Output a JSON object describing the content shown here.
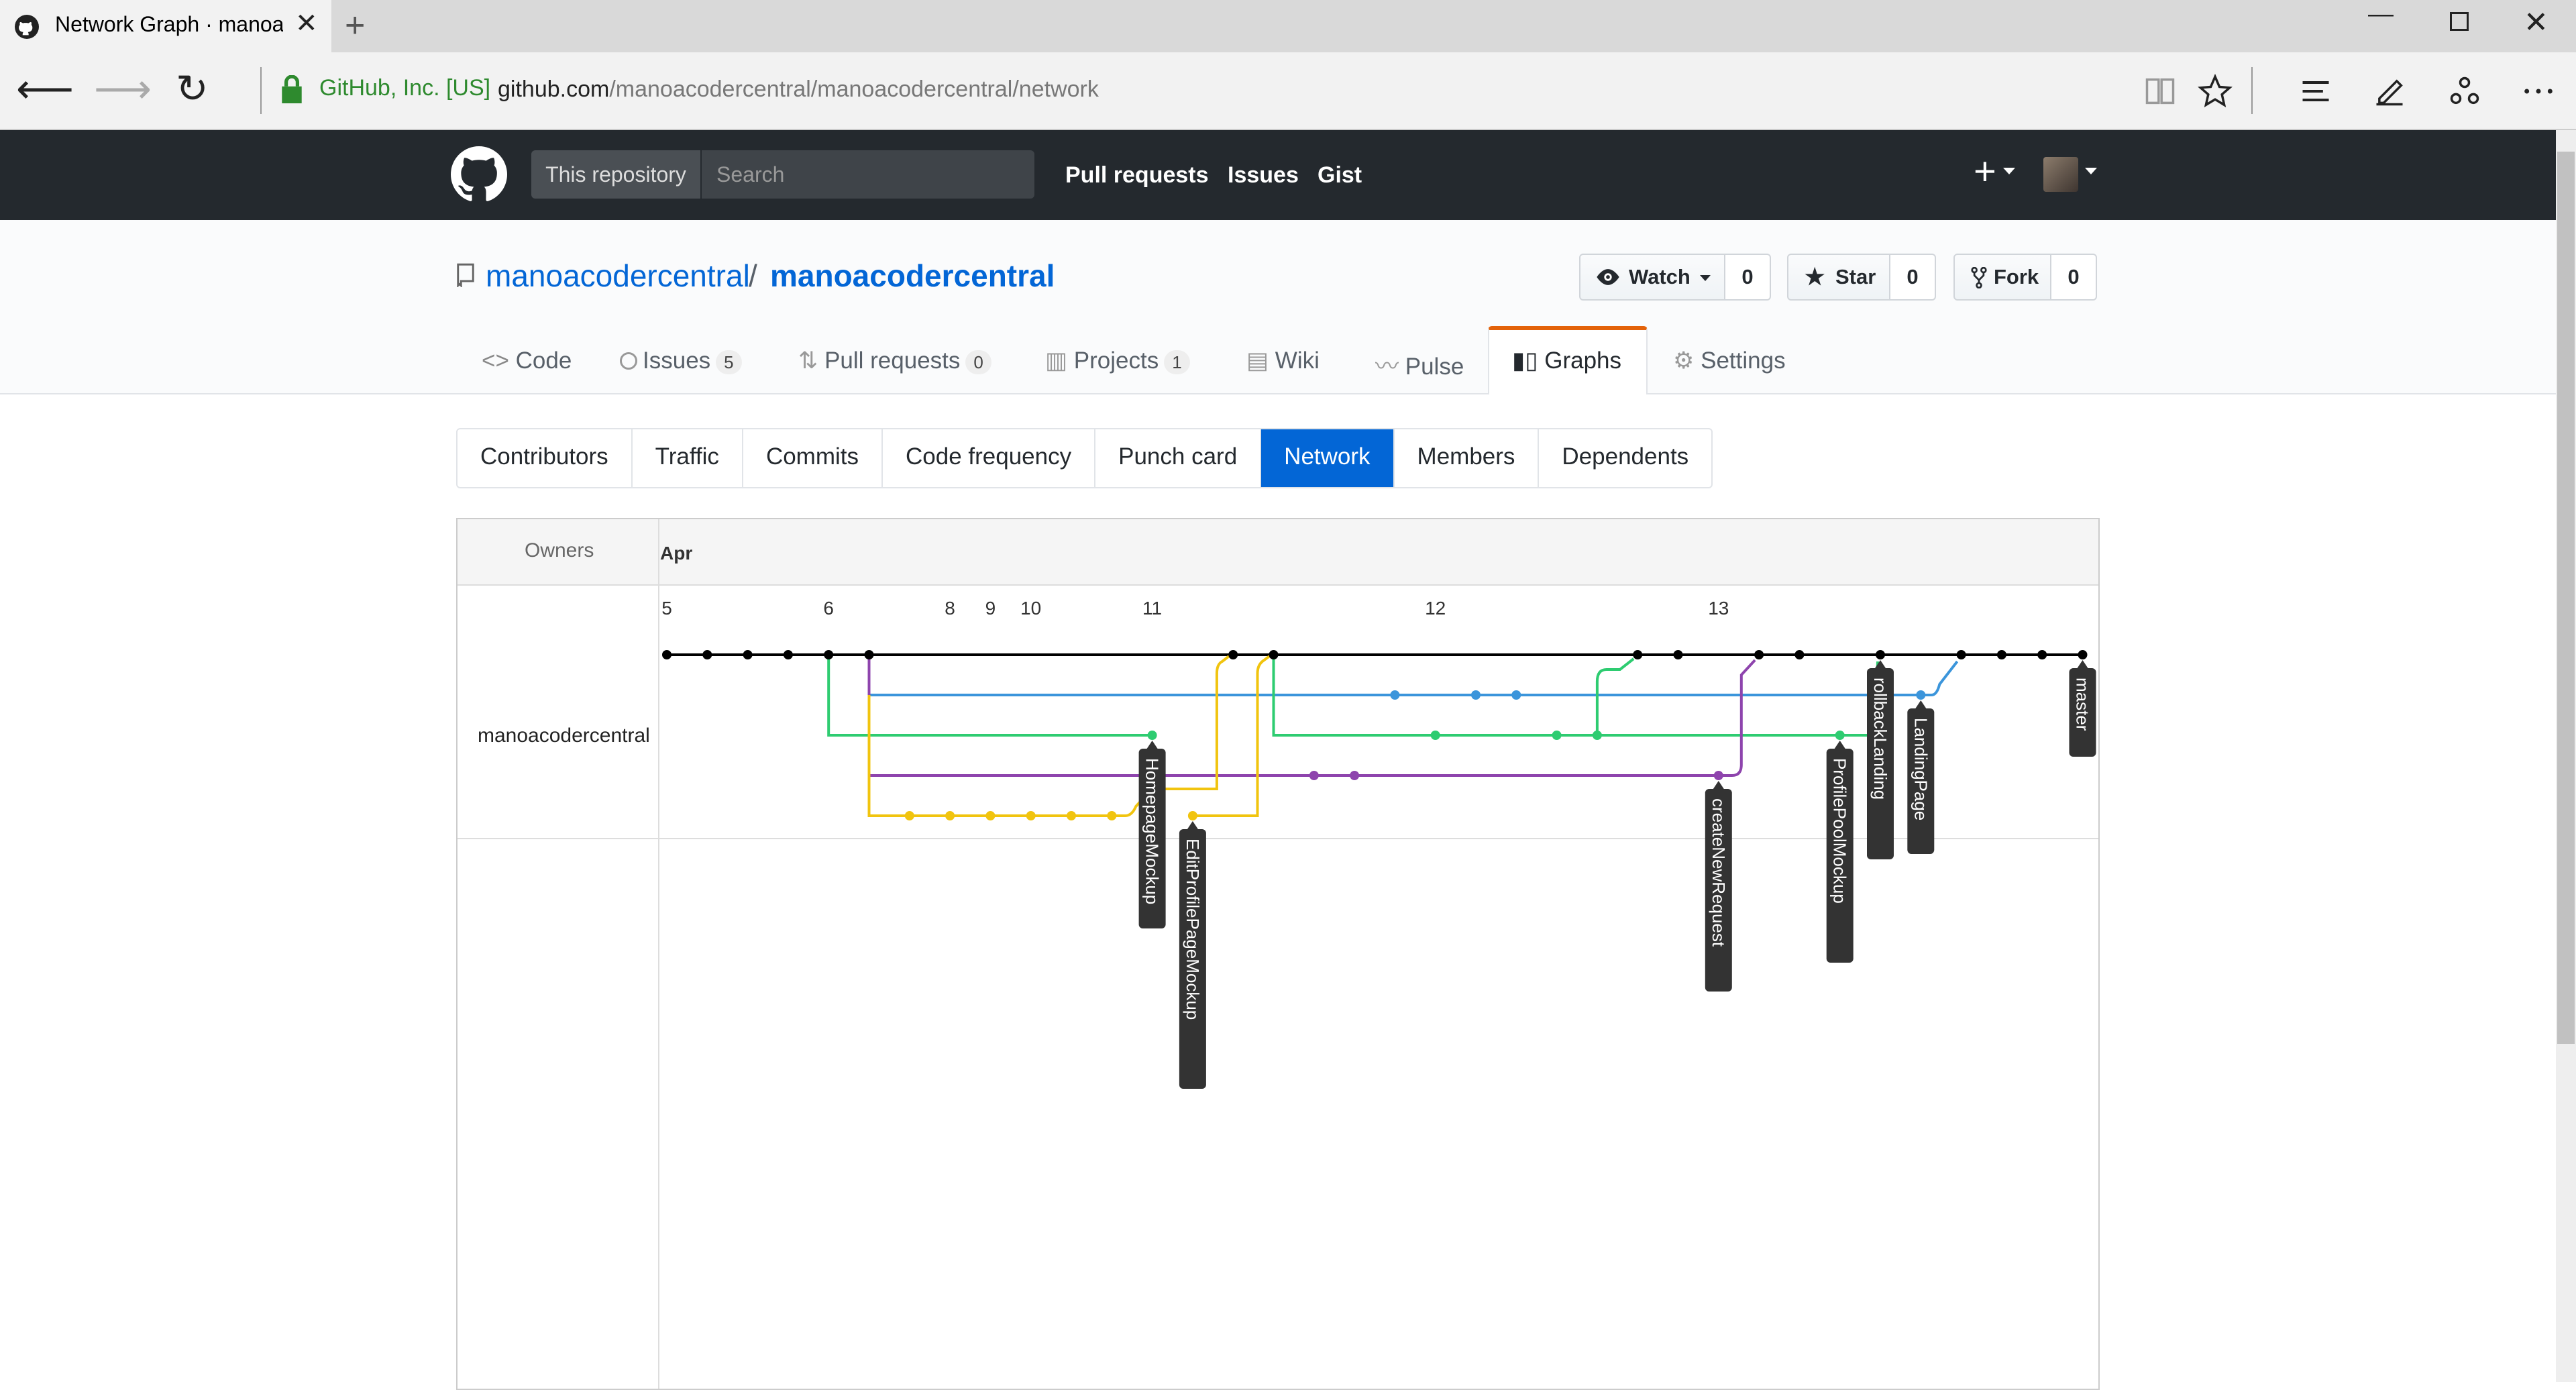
{
  "browser": {
    "tab_title": "Network Graph · manoa",
    "cert_label": "GitHub, Inc. [US]",
    "url_domain": "github.com",
    "url_path": "/manoacodercentral/manoacodercentral/network",
    "icons": [
      "back-arrow-icon",
      "forward-arrow-icon",
      "refresh-icon",
      "lock-icon",
      "reading-view-icon",
      "favorite-star-icon",
      "hub-icon",
      "web-note-icon",
      "share-icon",
      "more-icon"
    ]
  },
  "gh": {
    "scope": "This repository",
    "search_placeholder": "Search",
    "nav": [
      "Pull requests",
      "Issues",
      "Gist"
    ]
  },
  "repo": {
    "owner": "manoacodercentral",
    "slash": "/",
    "name": "manoacodercentral",
    "watch_label": "Watch",
    "watch_count": "0",
    "star_label": "Star",
    "star_count": "0",
    "fork_label": "Fork",
    "fork_count": "0"
  },
  "reponav": {
    "code": "Code",
    "issues": "Issues",
    "issues_count": "5",
    "pulls": "Pull requests",
    "pulls_count": "0",
    "projects": "Projects",
    "projects_count": "1",
    "wiki": "Wiki",
    "pulse": "Pulse",
    "graphs": "Graphs",
    "settings": "Settings"
  },
  "subnav": [
    "Contributors",
    "Traffic",
    "Commits",
    "Code frequency",
    "Punch card",
    "Network",
    "Members",
    "Dependents"
  ],
  "subnav_selected": "Network",
  "network": {
    "owners_label": "Owners",
    "month_label": "Apr",
    "owner": "manoacodercentral",
    "colors": {
      "master": "#000000",
      "blue": "#3b95db",
      "green": "#2ecc71",
      "purple": "#8e44ad",
      "yellow": "#f1c40f",
      "label_bg": "#333333"
    },
    "day_ticks": [
      {
        "day": "5",
        "col": 0
      },
      {
        "day": "6",
        "col": 4
      },
      {
        "day": "8",
        "col": 7
      },
      {
        "day": "9",
        "col": 8
      },
      {
        "day": "10",
        "col": 9
      },
      {
        "day": "11",
        "col": 12
      },
      {
        "day": "12",
        "col": 19
      },
      {
        "day": "13",
        "col": 26
      }
    ],
    "branches": [
      {
        "name": "master",
        "color": "#000000",
        "lane": 0,
        "col": 35
      },
      {
        "name": "rollbackLanding",
        "color": "#2ecc71",
        "lane": 0,
        "col": 30
      },
      {
        "name": "LandingPage",
        "color": "#3b95db",
        "lane": 1,
        "col": 31
      },
      {
        "name": "ProfilePoolMockup",
        "color": "#2ecc71",
        "lane": 2,
        "col": 29
      },
      {
        "name": "createNewRequest",
        "color": "#8e44ad",
        "lane": 3,
        "col": 26
      },
      {
        "name": "HomepageMockup",
        "color": "#2ecc71",
        "lane": 2,
        "col": 12
      },
      {
        "name": "EditProfilePageMockup",
        "color": "#f1c40f",
        "lane": 4,
        "col": 13
      }
    ]
  }
}
